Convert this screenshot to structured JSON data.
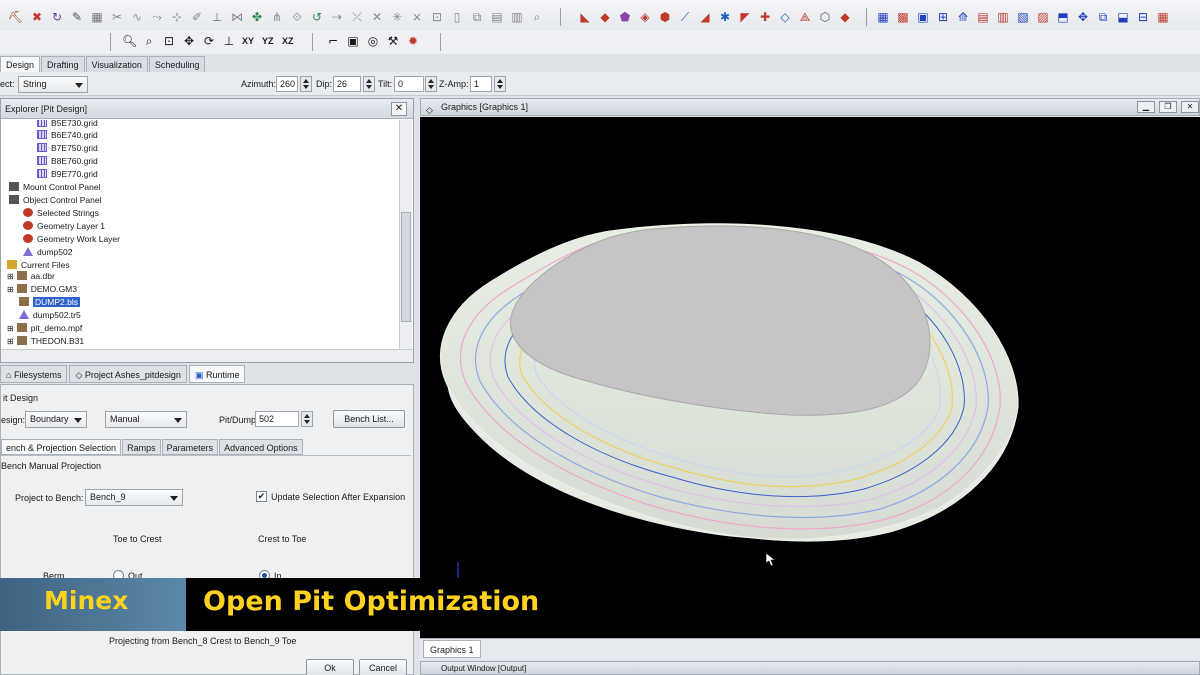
{
  "menu_tabs": [
    "Design",
    "Drafting",
    "Visualization",
    "Scheduling"
  ],
  "options": {
    "select_label": "ect:",
    "select_value": "String",
    "azimuth_label": "Azimuth:",
    "azimuth": "260",
    "dip_label": "Dip:",
    "dip": "26",
    "tilt_label": "Tilt:",
    "tilt": "0",
    "zamp_label": "Z-Amp:",
    "zamp": "1"
  },
  "toolbar_axes": [
    "XY",
    "YZ",
    "XZ"
  ],
  "explorer": {
    "title": "Explorer [Pit Design]",
    "items": [
      "B5E730.grid",
      "B6E740.grid",
      "B7E750.grid",
      "B8E760.grid",
      "B9E770.grid",
      "Mount Control Panel",
      "Object Control Panel",
      "Selected Strings",
      "Geometry Layer 1",
      "Geometry Work Layer",
      "dump502",
      "Current Files",
      "aa.dbr",
      "DEMO.GM3",
      "DUMP2.bls",
      "dump502.tr5",
      "pit_demo.mpf",
      "THEDON.B31"
    ]
  },
  "lower_tabs": [
    "Filesystems",
    "Project Ashes_pitdesign",
    "Runtime"
  ],
  "pit_design": {
    "section_title": "it Design",
    "design_label": "esign:",
    "design_value": "Boundary",
    "mode_value": "Manual",
    "pitdump_label": "Pit/Dump:",
    "pitdump_value": "502",
    "bench_list_button": "Bench List...",
    "sub_tabs": [
      "ench & Projection Selection",
      "Ramps",
      "Parameters",
      "Advanced Options"
    ],
    "group_label": "Bench Manual Projection",
    "project_to_bench_label": "Project to Bench:",
    "project_to_bench_value": "Bench_9",
    "update_selection_label": "Update Selection After Expansion",
    "toe_to_crest": "Toe to Crest",
    "crest_to_toe": "Crest to Toe",
    "berm_label": "Berm",
    "out_label": "Out",
    "in_label": "In",
    "projecting_text": "Projecting from Bench_8 Crest to Bench_9 Toe",
    "ok_button": "Ok",
    "cancel_button": "Cancel"
  },
  "graphics": {
    "title": "Graphics [Graphics 1]",
    "tab": "Graphics 1",
    "output_title": "Output Window [Output]"
  },
  "banner": {
    "brand": "Minex",
    "title": "Open Pit Optimization"
  },
  "colors": {
    "banner_text": "#ffd21f",
    "viewport_bg": "#000000",
    "selection": "#2f62c9"
  }
}
